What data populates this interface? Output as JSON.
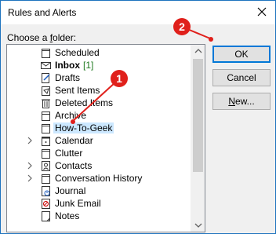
{
  "window": {
    "title": "Rules and Alerts",
    "close_label": "×"
  },
  "folder_picker": {
    "label": "Choose a folder:",
    "label_underline": "f",
    "folders": [
      {
        "name": "Scheduled",
        "icon": "folder-icon",
        "expandable": false,
        "bold": false,
        "count": ""
      },
      {
        "name": "Inbox",
        "icon": "inbox-icon",
        "expandable": false,
        "bold": true,
        "count": "[1]"
      },
      {
        "name": "Drafts",
        "icon": "drafts-icon",
        "expandable": false,
        "bold": false,
        "count": ""
      },
      {
        "name": "Sent Items",
        "icon": "sent-items-icon",
        "expandable": false,
        "bold": false,
        "count": ""
      },
      {
        "name": "Deleted Items",
        "icon": "deleted-items-icon",
        "expandable": false,
        "bold": false,
        "count": ""
      },
      {
        "name": "Archive",
        "icon": "archive-icon",
        "expandable": false,
        "bold": false,
        "count": ""
      },
      {
        "name": "How-To-Geek",
        "icon": "folder-icon",
        "expandable": false,
        "bold": false,
        "count": "",
        "selected": true
      },
      {
        "name": "Calendar",
        "icon": "calendar-icon",
        "expandable": true,
        "bold": false,
        "count": ""
      },
      {
        "name": "Clutter",
        "icon": "folder-icon",
        "expandable": false,
        "bold": false,
        "count": ""
      },
      {
        "name": "Contacts",
        "icon": "contacts-icon",
        "expandable": true,
        "bold": false,
        "count": ""
      },
      {
        "name": "Conversation History",
        "icon": "folder-icon",
        "expandable": true,
        "bold": false,
        "count": ""
      },
      {
        "name": "Journal",
        "icon": "journal-icon",
        "expandable": false,
        "bold": false,
        "count": ""
      },
      {
        "name": "Junk Email",
        "icon": "junk-email-icon",
        "expandable": false,
        "bold": false,
        "count": ""
      },
      {
        "name": "Notes",
        "icon": "notes-icon",
        "expandable": false,
        "bold": false,
        "count": ""
      }
    ]
  },
  "buttons": {
    "ok": "OK",
    "cancel": "Cancel",
    "new": "New..."
  },
  "annotations": {
    "callout_1": "1",
    "callout_2": "2",
    "color": "#e0201b"
  },
  "colors": {
    "selection": "#cce8ff",
    "default_button_border": "#0078d7",
    "count_green": "#1f7a1f"
  }
}
